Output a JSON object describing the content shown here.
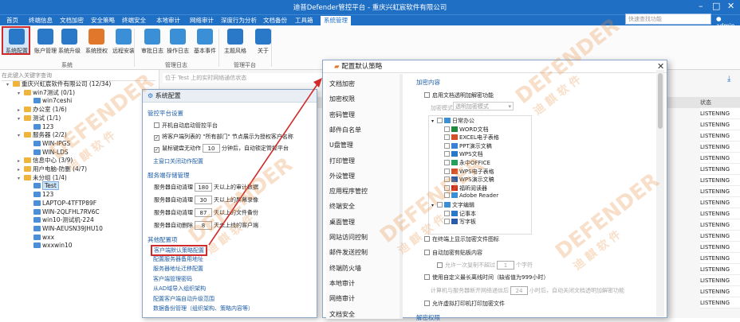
{
  "window": {
    "title": "迪普Defender管控平台 - 重庆兴虹宸软件有限公司"
  },
  "menu": [
    "首页",
    "终端信息",
    "文档加密",
    "安全策略",
    "终端安全",
    "本地审计",
    "网络审计",
    "深度行为分析",
    "文档备份",
    "工具箱",
    "系统管理"
  ],
  "search": {
    "placeholder": "快速查找功能"
  },
  "user": {
    "name": "admin"
  },
  "ribbon": {
    "buttons": [
      {
        "label": "系统配置",
        "icon": "gear-icon",
        "color": "#2a78c8"
      },
      {
        "label": "账户管理",
        "icon": "user-icon",
        "color": "#2a78c8"
      },
      {
        "label": "系统升级",
        "icon": "upgrade-arrow-icon",
        "color": "#2a78c8"
      },
      {
        "label": "系统授权",
        "icon": "license-icon",
        "color": "#e0772b"
      },
      {
        "label": "远程安装",
        "icon": "remote-install-icon",
        "color": "#3b8fd6"
      },
      {
        "label": "审批日志",
        "icon": "approval-log-icon",
        "color": "#3b8fd6"
      },
      {
        "label": "操作日志",
        "icon": "operation-log-icon",
        "color": "#3b8fd6"
      },
      {
        "label": "基本事件",
        "icon": "event-icon",
        "color": "#3b8fd6"
      },
      {
        "label": "主题风格",
        "icon": "shirt-icon",
        "color": "#2a78c8"
      },
      {
        "label": "关于",
        "icon": "info-icon",
        "color": "#2a78c8"
      }
    ],
    "groups": [
      "系统",
      "管理日志",
      "管理平台"
    ]
  },
  "tree": {
    "search_placeholder": "在此键入关键字查询",
    "nodes": [
      {
        "label": "重庆兴虹宸软件有限公司 (12/34)",
        "depth": 0,
        "expanded": true
      },
      {
        "label": "win7测试 (0/1)",
        "depth": 1,
        "expanded": true
      },
      {
        "label": "win7ceshi",
        "depth": 2
      },
      {
        "label": "办公室 (1/6)",
        "depth": 1
      },
      {
        "label": "测试 (1/1)",
        "depth": 1,
        "expanded": true
      },
      {
        "label": "123",
        "depth": 2
      },
      {
        "label": "服务器 (2/2)",
        "depth": 1,
        "expanded": true
      },
      {
        "label": "WIN-IPGS",
        "depth": 2
      },
      {
        "label": "WIN-LDS",
        "depth": 2
      },
      {
        "label": "信息中心 (3/9)",
        "depth": 1
      },
      {
        "label": "用户电脑-防删 (4/7)",
        "depth": 1
      },
      {
        "label": "未分组 (1/4)",
        "depth": 1,
        "expanded": true
      },
      {
        "label": "Test",
        "depth": 2,
        "selected": true
      },
      {
        "label": "123",
        "depth": 2
      },
      {
        "label": "LAPTOP-4TFTP89F",
        "depth": 2
      },
      {
        "label": "WIN-2QLFHL7RV6C",
        "depth": 2
      },
      {
        "label": "win10-测试机-224",
        "depth": 2
      },
      {
        "label": "WIN-AEUSN39JHU10",
        "depth": 2
      },
      {
        "label": "wxx",
        "depth": 2
      },
      {
        "label": "wxxwin10",
        "depth": 2
      }
    ]
  },
  "right": {
    "filter_placeholder": "位于 Test 上的实时网络通信状态",
    "header": "状态",
    "status_rows": [
      "LISTENING",
      "LISTENING",
      "LISTENING",
      "LISTENING",
      "LISTENING",
      "LISTENING",
      "LISTENING",
      "LISTENING",
      "LISTENING",
      "LISTENING",
      "LISTENING",
      "LISTENING",
      "LISTENING",
      "LISTENING",
      "LISTENING",
      "LISTENING",
      "LISTENING",
      "LISTENING"
    ]
  },
  "sys_dialog": {
    "title": "系统配置",
    "sec1": "管控平台设置",
    "chk1": "开机自动启动管控平台",
    "chk2": "将客户端列表的 \"所有部门\" 节点展示为授权客户名称",
    "chk3_pre": "鼠标键盘无动作",
    "chk3_val": "10",
    "chk3_post": "分钟后，自动锁定管控平台",
    "link_master": "主窗口关闭动作配置",
    "sec2": "服务端存储管理",
    "rows": [
      {
        "pre": "服务器自动清理",
        "val": "180",
        "post": "天以上的审计数据"
      },
      {
        "pre": "服务器自动清理",
        "val": "30",
        "post": "天以上的屏幕录像"
      },
      {
        "pre": "服务器自动清理",
        "val": "87",
        "post": "天以上的文件备份"
      },
      {
        "pre": "服务器自动删除",
        "val": "8",
        "post": "天未上线的客户端"
      }
    ],
    "sec3": "其他配置项",
    "links": [
      "客户端默认策略配置",
      "配置服务器备用地址",
      "服务器地址迁移配置",
      "客户端管理密码",
      "从AD域导入组织架构",
      "配置客户端自动升级范围",
      "数据备份管理（组织架构、策略内容等）"
    ]
  },
  "pol_dialog": {
    "title": "配置默认策略",
    "nav": [
      "文档加密",
      "加密权限",
      "密码管理",
      "邮件白名单",
      "U盘管理",
      "打印管理",
      "外设管理",
      "应用程序管控",
      "终端安全",
      "桌面管理",
      "网站访问控制",
      "邮件发送控制",
      "终端防火墙",
      "本地审计",
      "网络审计",
      "文档安全"
    ],
    "section": "加密内容",
    "chk_enable": "启用文档透明加解密功能",
    "mode_label": "加密模式",
    "mode_value": "透明加密模式",
    "types": [
      {
        "label": "日常办公",
        "depth": 0,
        "folder": true
      },
      {
        "label": "WORD文档",
        "depth": 1
      },
      {
        "label": "EXCEL电子表格",
        "depth": 1
      },
      {
        "label": "PPT演示文稿",
        "depth": 1
      },
      {
        "label": "WPS文档",
        "depth": 1
      },
      {
        "label": "永中OFFICE",
        "depth": 1
      },
      {
        "label": "WPS电子表格",
        "depth": 1
      },
      {
        "label": "WPS演示文稿",
        "depth": 1
      },
      {
        "label": "福昕阅读器",
        "depth": 1
      },
      {
        "label": "Adobe Reader",
        "depth": 1
      },
      {
        "label": "文字编辑",
        "depth": 0,
        "folder": true
      },
      {
        "label": "记事本",
        "depth": 1
      },
      {
        "label": "写字板",
        "depth": 1
      }
    ],
    "opts": [
      {
        "label": "在终端上显示加密文件图标"
      },
      {
        "label": "自动加密剪贴板内容"
      },
      {
        "label": "允许一次复制不超过",
        "val": "1",
        "post": "个字符",
        "disabled": true
      },
      {
        "label": "使用自定义最长离线时间（缺省值为999小时）"
      },
      {
        "label": "计算机与服务器断开网络通信后",
        "val": "24",
        "post": "小时后，自动关闭文档透明加解密功能",
        "disabled": true,
        "plain": true
      },
      {
        "label": "允许虚拟打印机打印加密文件"
      }
    ],
    "last_section": "解密权限"
  },
  "watermark": {
    "brand": "DEFENDER",
    "cn": "迪 麒 软 件"
  }
}
